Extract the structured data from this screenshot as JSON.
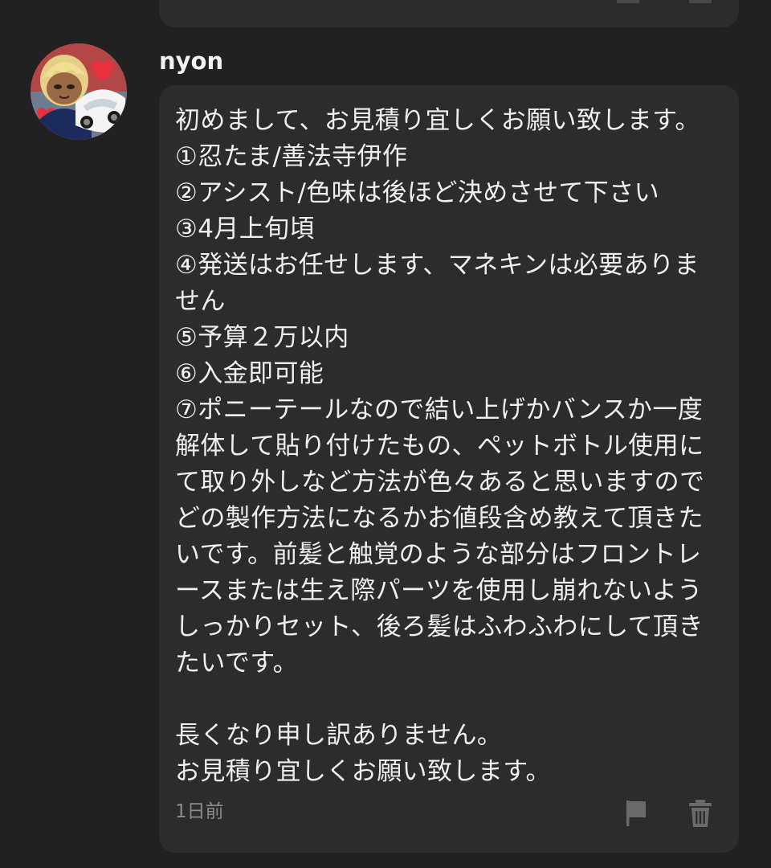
{
  "comment": {
    "username": "nyon",
    "message_lines": [
      "初めまして、お見積り宜しくお願い致します。",
      "①忍たま/善法寺伊作",
      "②アシスト/色味は後ほど決めさせて下さい",
      "③4月上旬頃",
      "④発送はお任せします、マネキンは必要ありま",
      "せん",
      "⑤予算２万以内",
      "⑥入金即可能",
      "⑦ポニーテールなので結い上げかバンスか一度",
      "解体して貼り付けたもの、ペットボトル使用に",
      "て取り外しなど方法が色々あると思いますので",
      "どの製作方法になるかお値段含め教えて頂きた",
      "いです。前髪と触覚のような部分はフロントレ",
      "ースまたは生え際パーツを使用し崩れないよう",
      "しっかりセット、後ろ髪はふわふわにして頂き",
      "たいです。",
      "",
      "長くなり申し訳ありません。",
      "お見積り宜しくお願い致します。"
    ],
    "timestamp": "1日前",
    "actions": {
      "report_icon": "flag-icon",
      "delete_icon": "trash-icon"
    }
  },
  "colors": {
    "background": "#212121",
    "bubble": "#2c2c2c",
    "text": "#efefef",
    "muted": "#8a8a8a",
    "icon": "#6a6a6a"
  }
}
